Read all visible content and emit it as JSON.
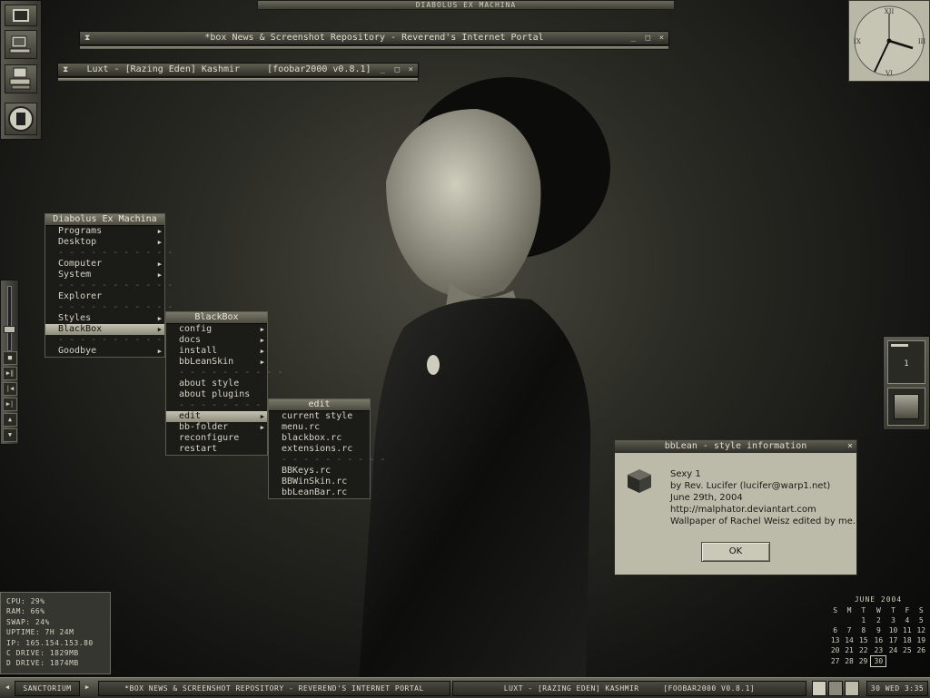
{
  "desktop": {
    "top_title": "DIABOLUS EX MACHINA"
  },
  "windows": [
    {
      "title": "*box News & Screenshot Repository - Reverend's Internet Portal",
      "buttons": [
        "_",
        "□",
        "×"
      ]
    },
    {
      "title": "Luxt - [Razing Eden] Kashmir     [foobar2000 v0.8.1]",
      "buttons": [
        "_",
        "□",
        "×"
      ]
    }
  ],
  "clock": {
    "numerals": [
      "XII",
      "III",
      "VI",
      "IX"
    ],
    "time": "3:35"
  },
  "root_menu": {
    "title": "Diabolus Ex Machina",
    "items": [
      {
        "label": "Programs",
        "submenu": true
      },
      {
        "label": "Desktop",
        "submenu": true
      },
      {
        "label": "- - - - - - - - - - -",
        "separator": true
      },
      {
        "label": "Computer",
        "submenu": true
      },
      {
        "label": "System",
        "submenu": true
      },
      {
        "label": "- - - - - - - - - - -",
        "separator": true
      },
      {
        "label": "Explorer"
      },
      {
        "label": "- - - - - - - - - - -",
        "separator": true
      },
      {
        "label": "Styles",
        "submenu": true
      },
      {
        "label": "BlackBox",
        "submenu": true,
        "selected": true
      },
      {
        "label": "- - - - - - - - - - -",
        "separator": true
      },
      {
        "label": "Goodbye",
        "submenu": true
      }
    ]
  },
  "blackbox_menu": {
    "title": "BlackBox",
    "items": [
      {
        "label": "config",
        "submenu": true
      },
      {
        "label": "docs",
        "submenu": true
      },
      {
        "label": "install",
        "submenu": true
      },
      {
        "label": "bbLeanSkin",
        "submenu": true
      },
      {
        "label": "- - - - - - - - - -",
        "separator": true
      },
      {
        "label": "about style"
      },
      {
        "label": "about plugins"
      },
      {
        "label": "- - - - - - - - - -",
        "separator": true
      },
      {
        "label": "edit",
        "submenu": true,
        "selected": true
      },
      {
        "label": "bb-folder",
        "submenu": true
      },
      {
        "label": "reconfigure"
      },
      {
        "label": "restart"
      }
    ]
  },
  "edit_menu": {
    "title": "edit",
    "items": [
      {
        "label": "current style"
      },
      {
        "label": "menu.rc"
      },
      {
        "label": "blackbox.rc"
      },
      {
        "label": "extensions.rc"
      },
      {
        "label": "- - - - - - - - - -",
        "separator": true
      },
      {
        "label": "BBKeys.rc"
      },
      {
        "label": "BBWinSkin.rc"
      },
      {
        "label": "bbLeanBar.rc"
      }
    ]
  },
  "style_dialog": {
    "title": "bbLean - style information",
    "lines": [
      "Sexy 1",
      "by Rev. Lucifer (lucifer@warp1.net)",
      "June 29th, 2004",
      "http://malphator.deviantart.com",
      "Wallpaper of Rachel Weisz edited by me."
    ],
    "ok_label": "OK"
  },
  "right_panel": {
    "workspace_number": "1"
  },
  "sysmon": {
    "lines": [
      "CPU: 29%",
      "RAM: 66%",
      "SWAP: 24%",
      "UPTIME: 7H 24M",
      "IP: 165.154.153.80",
      "C DRIVE: 1829MB",
      "D DRIVE: 1874MB"
    ]
  },
  "calendar": {
    "month": "JUNE 2004",
    "days": [
      "S",
      "M",
      "T",
      "W",
      "T",
      "F",
      "S"
    ],
    "weeks": [
      [
        "",
        "",
        "1",
        "2",
        "3",
        "4",
        "5"
      ],
      [
        "6",
        "7",
        "8",
        "9",
        "10",
        "11",
        "12"
      ],
      [
        "13",
        "14",
        "15",
        "16",
        "17",
        "18",
        "19"
      ],
      [
        "20",
        "21",
        "22",
        "23",
        "24",
        "25",
        "26"
      ],
      [
        "27",
        "28",
        "29",
        "30",
        "",
        "",
        ""
      ]
    ],
    "today": "30"
  },
  "taskbar": {
    "workspace": "SANCTORIUM",
    "tasks": [
      "*BOX NEWS & SCREENSHOT REPOSITORY - REVEREND'S INTERNET PORTAL",
      "LUXT - [RAZING EDEN] KASHMIR     [FOOBAR2000 V0.8.1]"
    ],
    "clock": "30 WED 3:35"
  }
}
